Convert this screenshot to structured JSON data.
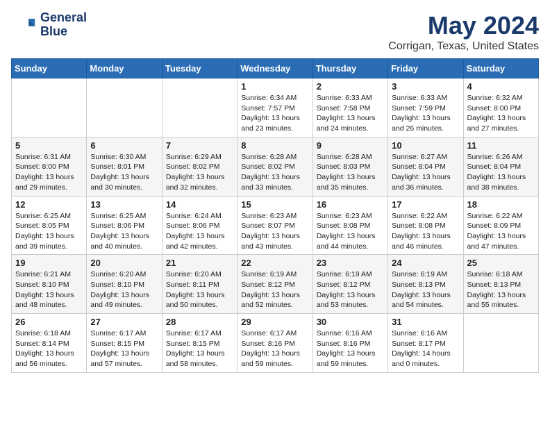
{
  "logo": {
    "line1": "General",
    "line2": "Blue"
  },
  "title": "May 2024",
  "subtitle": "Corrigan, Texas, United States",
  "header_color": "#2a6db5",
  "days_of_week": [
    "Sunday",
    "Monday",
    "Tuesday",
    "Wednesday",
    "Thursday",
    "Friday",
    "Saturday"
  ],
  "weeks": [
    [
      {
        "day": "",
        "info": ""
      },
      {
        "day": "",
        "info": ""
      },
      {
        "day": "",
        "info": ""
      },
      {
        "day": "1",
        "info": "Sunrise: 6:34 AM\nSunset: 7:57 PM\nDaylight: 13 hours\nand 23 minutes."
      },
      {
        "day": "2",
        "info": "Sunrise: 6:33 AM\nSunset: 7:58 PM\nDaylight: 13 hours\nand 24 minutes."
      },
      {
        "day": "3",
        "info": "Sunrise: 6:33 AM\nSunset: 7:59 PM\nDaylight: 13 hours\nand 26 minutes."
      },
      {
        "day": "4",
        "info": "Sunrise: 6:32 AM\nSunset: 8:00 PM\nDaylight: 13 hours\nand 27 minutes."
      }
    ],
    [
      {
        "day": "5",
        "info": "Sunrise: 6:31 AM\nSunset: 8:00 PM\nDaylight: 13 hours\nand 29 minutes."
      },
      {
        "day": "6",
        "info": "Sunrise: 6:30 AM\nSunset: 8:01 PM\nDaylight: 13 hours\nand 30 minutes."
      },
      {
        "day": "7",
        "info": "Sunrise: 6:29 AM\nSunset: 8:02 PM\nDaylight: 13 hours\nand 32 minutes."
      },
      {
        "day": "8",
        "info": "Sunrise: 6:28 AM\nSunset: 8:02 PM\nDaylight: 13 hours\nand 33 minutes."
      },
      {
        "day": "9",
        "info": "Sunrise: 6:28 AM\nSunset: 8:03 PM\nDaylight: 13 hours\nand 35 minutes."
      },
      {
        "day": "10",
        "info": "Sunrise: 6:27 AM\nSunset: 8:04 PM\nDaylight: 13 hours\nand 36 minutes."
      },
      {
        "day": "11",
        "info": "Sunrise: 6:26 AM\nSunset: 8:04 PM\nDaylight: 13 hours\nand 38 minutes."
      }
    ],
    [
      {
        "day": "12",
        "info": "Sunrise: 6:25 AM\nSunset: 8:05 PM\nDaylight: 13 hours\nand 39 minutes."
      },
      {
        "day": "13",
        "info": "Sunrise: 6:25 AM\nSunset: 8:06 PM\nDaylight: 13 hours\nand 40 minutes."
      },
      {
        "day": "14",
        "info": "Sunrise: 6:24 AM\nSunset: 8:06 PM\nDaylight: 13 hours\nand 42 minutes."
      },
      {
        "day": "15",
        "info": "Sunrise: 6:23 AM\nSunset: 8:07 PM\nDaylight: 13 hours\nand 43 minutes."
      },
      {
        "day": "16",
        "info": "Sunrise: 6:23 AM\nSunset: 8:08 PM\nDaylight: 13 hours\nand 44 minutes."
      },
      {
        "day": "17",
        "info": "Sunrise: 6:22 AM\nSunset: 8:08 PM\nDaylight: 13 hours\nand 46 minutes."
      },
      {
        "day": "18",
        "info": "Sunrise: 6:22 AM\nSunset: 8:09 PM\nDaylight: 13 hours\nand 47 minutes."
      }
    ],
    [
      {
        "day": "19",
        "info": "Sunrise: 6:21 AM\nSunset: 8:10 PM\nDaylight: 13 hours\nand 48 minutes."
      },
      {
        "day": "20",
        "info": "Sunrise: 6:20 AM\nSunset: 8:10 PM\nDaylight: 13 hours\nand 49 minutes."
      },
      {
        "day": "21",
        "info": "Sunrise: 6:20 AM\nSunset: 8:11 PM\nDaylight: 13 hours\nand 50 minutes."
      },
      {
        "day": "22",
        "info": "Sunrise: 6:19 AM\nSunset: 8:12 PM\nDaylight: 13 hours\nand 52 minutes."
      },
      {
        "day": "23",
        "info": "Sunrise: 6:19 AM\nSunset: 8:12 PM\nDaylight: 13 hours\nand 53 minutes."
      },
      {
        "day": "24",
        "info": "Sunrise: 6:19 AM\nSunset: 8:13 PM\nDaylight: 13 hours\nand 54 minutes."
      },
      {
        "day": "25",
        "info": "Sunrise: 6:18 AM\nSunset: 8:13 PM\nDaylight: 13 hours\nand 55 minutes."
      }
    ],
    [
      {
        "day": "26",
        "info": "Sunrise: 6:18 AM\nSunset: 8:14 PM\nDaylight: 13 hours\nand 56 minutes."
      },
      {
        "day": "27",
        "info": "Sunrise: 6:17 AM\nSunset: 8:15 PM\nDaylight: 13 hours\nand 57 minutes."
      },
      {
        "day": "28",
        "info": "Sunrise: 6:17 AM\nSunset: 8:15 PM\nDaylight: 13 hours\nand 58 minutes."
      },
      {
        "day": "29",
        "info": "Sunrise: 6:17 AM\nSunset: 8:16 PM\nDaylight: 13 hours\nand 59 minutes."
      },
      {
        "day": "30",
        "info": "Sunrise: 6:16 AM\nSunset: 8:16 PM\nDaylight: 13 hours\nand 59 minutes."
      },
      {
        "day": "31",
        "info": "Sunrise: 6:16 AM\nSunset: 8:17 PM\nDaylight: 14 hours\nand 0 minutes."
      },
      {
        "day": "",
        "info": ""
      }
    ]
  ]
}
